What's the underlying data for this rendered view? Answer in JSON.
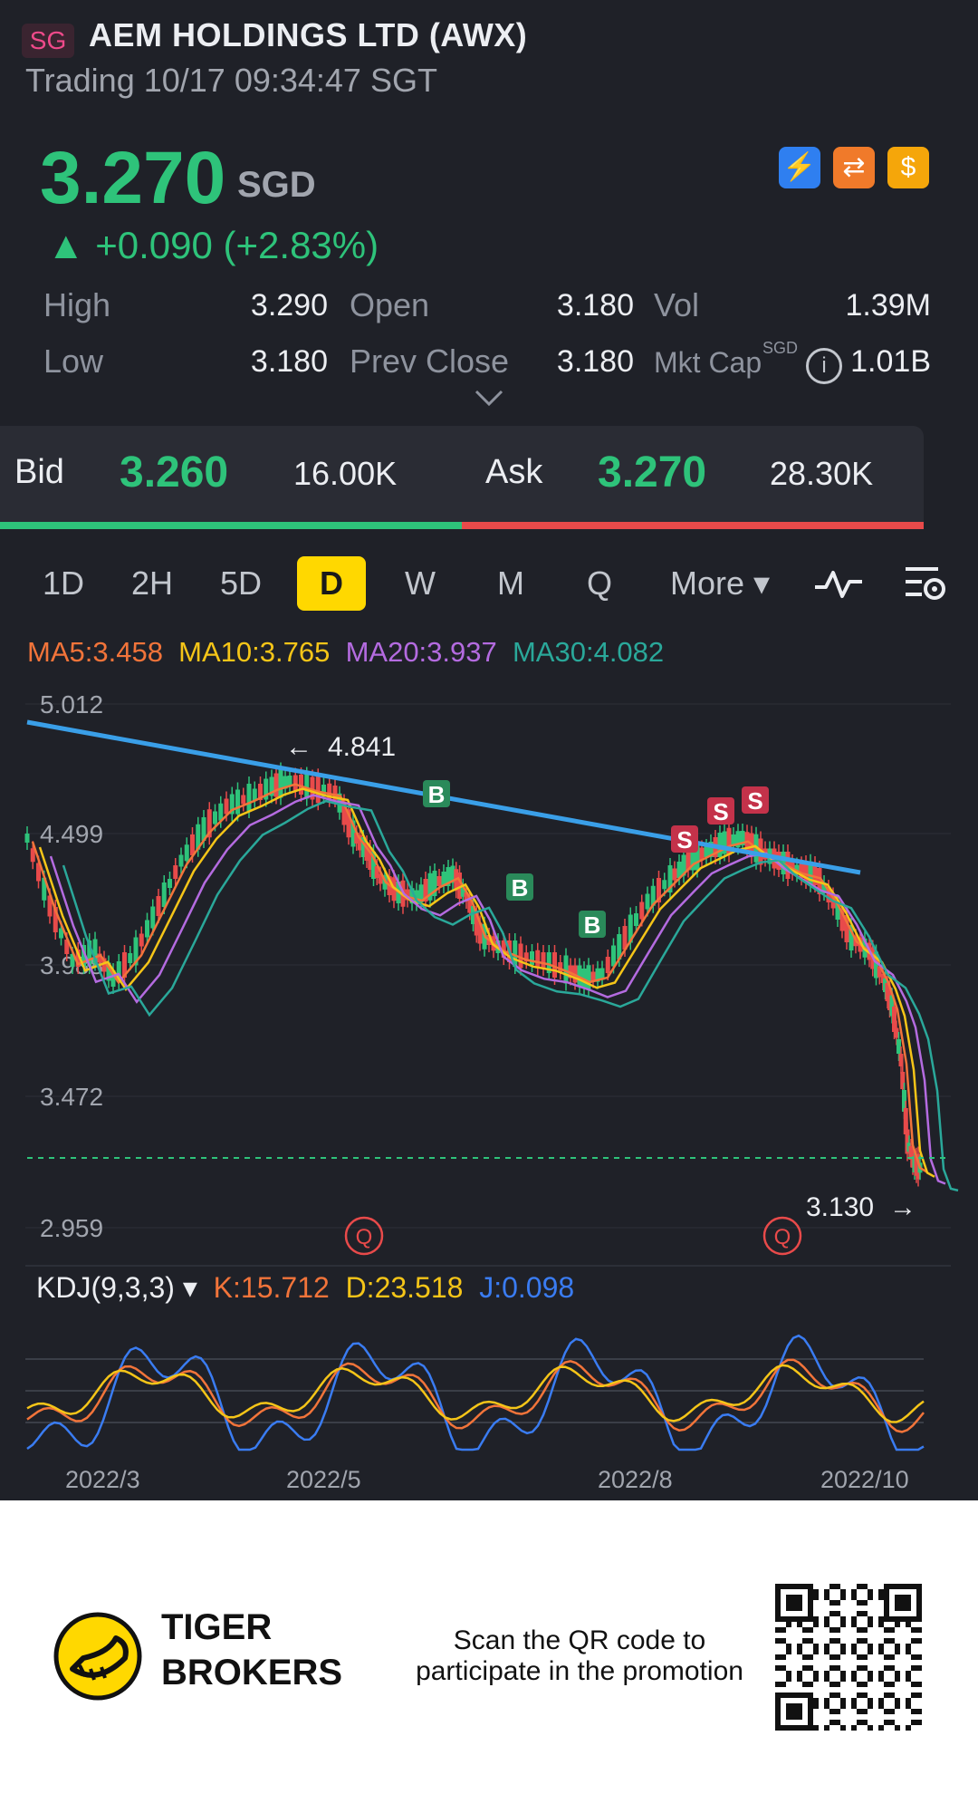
{
  "header": {
    "market_badge": "SG",
    "title": "AEM HOLDINGS LTD (AWX)",
    "status": "Trading 10/17 09:34:47 SGT",
    "price": "3.270",
    "currency": "SGD",
    "change": "▲ +0.090 (+2.83%)",
    "icons": [
      "lightning-icon",
      "exchange-icon",
      "dollar-icon"
    ],
    "stats": {
      "high_label": "High",
      "high": "3.290",
      "low_label": "Low",
      "low": "3.180",
      "open_label": "Open",
      "open": "3.180",
      "prev_close_label": "Prev Close",
      "prev_close": "3.180",
      "vol_label": "Vol",
      "vol": "1.39M",
      "mkt_cap_label": "Mkt Cap",
      "mkt_cap_sup": "SGD",
      "mkt_cap": "1.01B"
    }
  },
  "bidask": {
    "bid_label": "Bid",
    "bid": "3.260",
    "bid_size": "16.00K",
    "ask_label": "Ask",
    "ask": "3.270",
    "ask_size": "28.30K"
  },
  "tabs": [
    "1D",
    "2H",
    "5D",
    "D",
    "W",
    "M",
    "Q",
    "More ▾"
  ],
  "active_tab": "D",
  "ma_legend": {
    "ma5": "MA5:3.458",
    "ma10": "MA10:3.765",
    "ma20": "MA20:3.937",
    "ma30": "MA30:4.082"
  },
  "colors": {
    "up": "#2ec37a",
    "down": "#e84a4a",
    "ma5": "#f2743a",
    "ma10": "#f5c518",
    "ma20": "#b46be0",
    "ma30": "#2aa89a",
    "trend": "#3a9fe8",
    "accent": "#ffd800"
  },
  "chart_data": {
    "type": "line",
    "y_ticks": [
      "5.012",
      "4.499",
      "3.988",
      "3.472",
      "2.959"
    ],
    "high_marker": "4.841",
    "low_marker": "3.130",
    "x_ticks": [
      "2022/3",
      "2022/5",
      "2022/8",
      "2022/10"
    ],
    "signals": [
      "B",
      "B",
      "B",
      "S",
      "S",
      "S"
    ],
    "event_marks": [
      "Q",
      "Q"
    ],
    "series": [
      {
        "name": "MA5",
        "value": 3.458
      },
      {
        "name": "MA10",
        "value": 3.765
      },
      {
        "name": "MA20",
        "value": 3.937
      },
      {
        "name": "MA30",
        "value": 4.082
      }
    ]
  },
  "kdj": {
    "label": "KDJ(9,3,3) ▾",
    "k": "K:15.712",
    "d": "D:23.518",
    "j": "J:0.098"
  },
  "footer": {
    "brand_line1": "TIGER",
    "brand_line2": "BROKERS",
    "scan_text": "Scan the QR code to participate in the promotion"
  }
}
